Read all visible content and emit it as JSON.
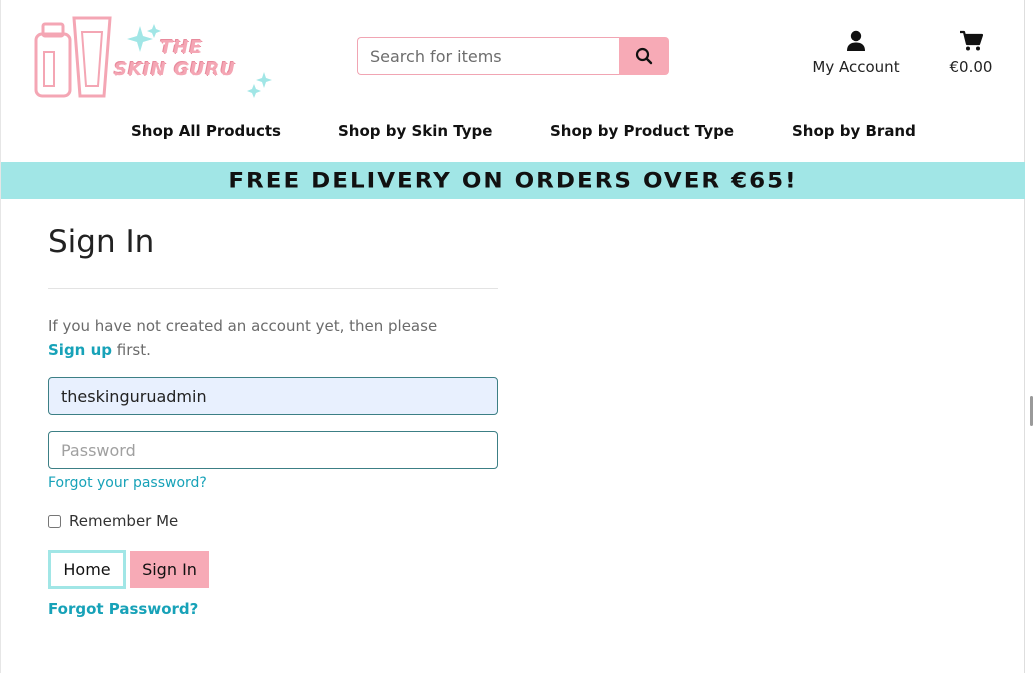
{
  "brand": {
    "line1": "THE",
    "line2": "SKIN GURU",
    "colors": {
      "pink": "#f7aab6",
      "aqua": "#a1e6e6",
      "teal": "#17a2b8"
    }
  },
  "header": {
    "search": {
      "placeholder": "Search for items",
      "icon": "search-icon"
    },
    "account": {
      "label": "My Account",
      "icon": "user-icon"
    },
    "cart": {
      "label": "€0.00",
      "icon": "cart-icon"
    }
  },
  "nav": {
    "items": [
      {
        "label": "Shop All Products"
      },
      {
        "label": "Shop by Skin Type"
      },
      {
        "label": "Shop by Product Type"
      },
      {
        "label": "Shop by Brand"
      }
    ]
  },
  "banner": {
    "text": "FREE DELIVERY ON ORDERS OVER €65!"
  },
  "signin": {
    "title": "Sign In",
    "note_before": "If you have not created an account yet, then please",
    "note_link": "Sign up",
    "note_after": "first.",
    "username_value": "theskinguruadmin",
    "password_placeholder": "Password",
    "forgot_small": "Forgot your password?",
    "remember_label": "Remember Me",
    "home_button": "Home",
    "signin_button": "Sign In",
    "forgot_big": "Forgot Password?"
  }
}
